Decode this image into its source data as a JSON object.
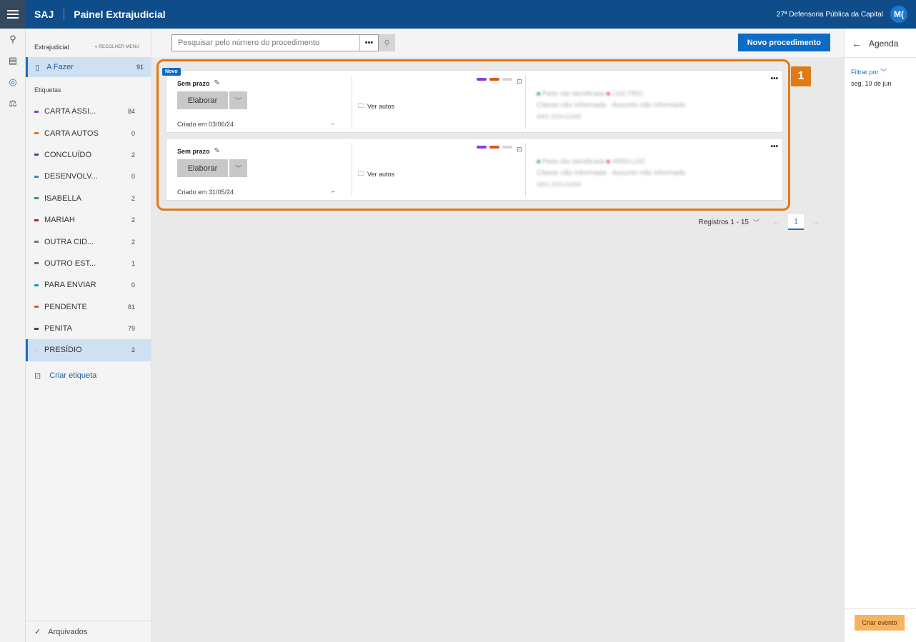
{
  "topbar": {
    "brand": "SAJ",
    "title": "Painel Extrajudicial",
    "org": "27ª Defensoria Pública da Capital",
    "avatar": "M("
  },
  "sidebar": {
    "section": "Extrajudicial",
    "collapse_label": "« RECOLHER MENU",
    "afazer": {
      "label": "A Fazer",
      "count": "91"
    },
    "tags_title": "Etiquetas",
    "tags": [
      {
        "name": "CARTA ASSI...",
        "count": "84",
        "color": "#8a3fd1"
      },
      {
        "name": "CARTA AUTOS",
        "count": "0",
        "color": "#d47a1a"
      },
      {
        "name": "CONCLUÍDO",
        "count": "2",
        "color": "#2d4fa0"
      },
      {
        "name": "DESENVOLV...",
        "count": "0",
        "color": "#2a8fd4"
      },
      {
        "name": "ISABELLA",
        "count": "2",
        "color": "#2e9a48"
      },
      {
        "name": "MARIAH",
        "count": "2",
        "color": "#b52222"
      },
      {
        "name": "OUTRA CID...",
        "count": "2",
        "color": "#8a6a6a"
      },
      {
        "name": "OUTRO EST...",
        "count": "1",
        "color": "#7a6a60"
      },
      {
        "name": "PARA ENVIAR",
        "count": "0",
        "color": "#139aa8"
      },
      {
        "name": "PENDENTE",
        "count": "81",
        "color": "#e0541a"
      },
      {
        "name": "PENITA",
        "count": "79",
        "color": "#3a4a5e"
      },
      {
        "name": "PRESÍDIO",
        "count": "2",
        "color": "#cfd8e2"
      }
    ],
    "create_tag": "Criar etiqueta",
    "archived": "Arquivados"
  },
  "toolbar": {
    "search_placeholder": "Pesquisar pelo número do procedimento",
    "more": "•••",
    "new_button": "Novo procedimento"
  },
  "callout": "1",
  "cards": [
    {
      "badge": "Novo",
      "deadline": "Sem prazo",
      "action": "Elaborar",
      "created": "Criado em 03/06/24",
      "link": "Ver autos",
      "blur1": "Parte não identificada",
      "blur1b": "LUIZ FRIO",
      "blur2": "Classe não informada · Assunto não informado",
      "blur3": "0001.2024.01000"
    },
    {
      "badge": "",
      "deadline": "Sem prazo",
      "action": "Elaborar",
      "created": "Criado em 31/05/24",
      "link": "Ver autos",
      "blur1": "Parte não identificada",
      "blur1b": "VERA LUIZ",
      "blur2": "Classe não informada · Assunto não informado",
      "blur3": "0001.2024.01000"
    }
  ],
  "pager": {
    "records": "Registros 1 - 15",
    "page": "1"
  },
  "agenda": {
    "title": "Agenda",
    "filter": "Filtrar por",
    "date": "seg, 10 de jun",
    "create_event": "Criar evento"
  }
}
